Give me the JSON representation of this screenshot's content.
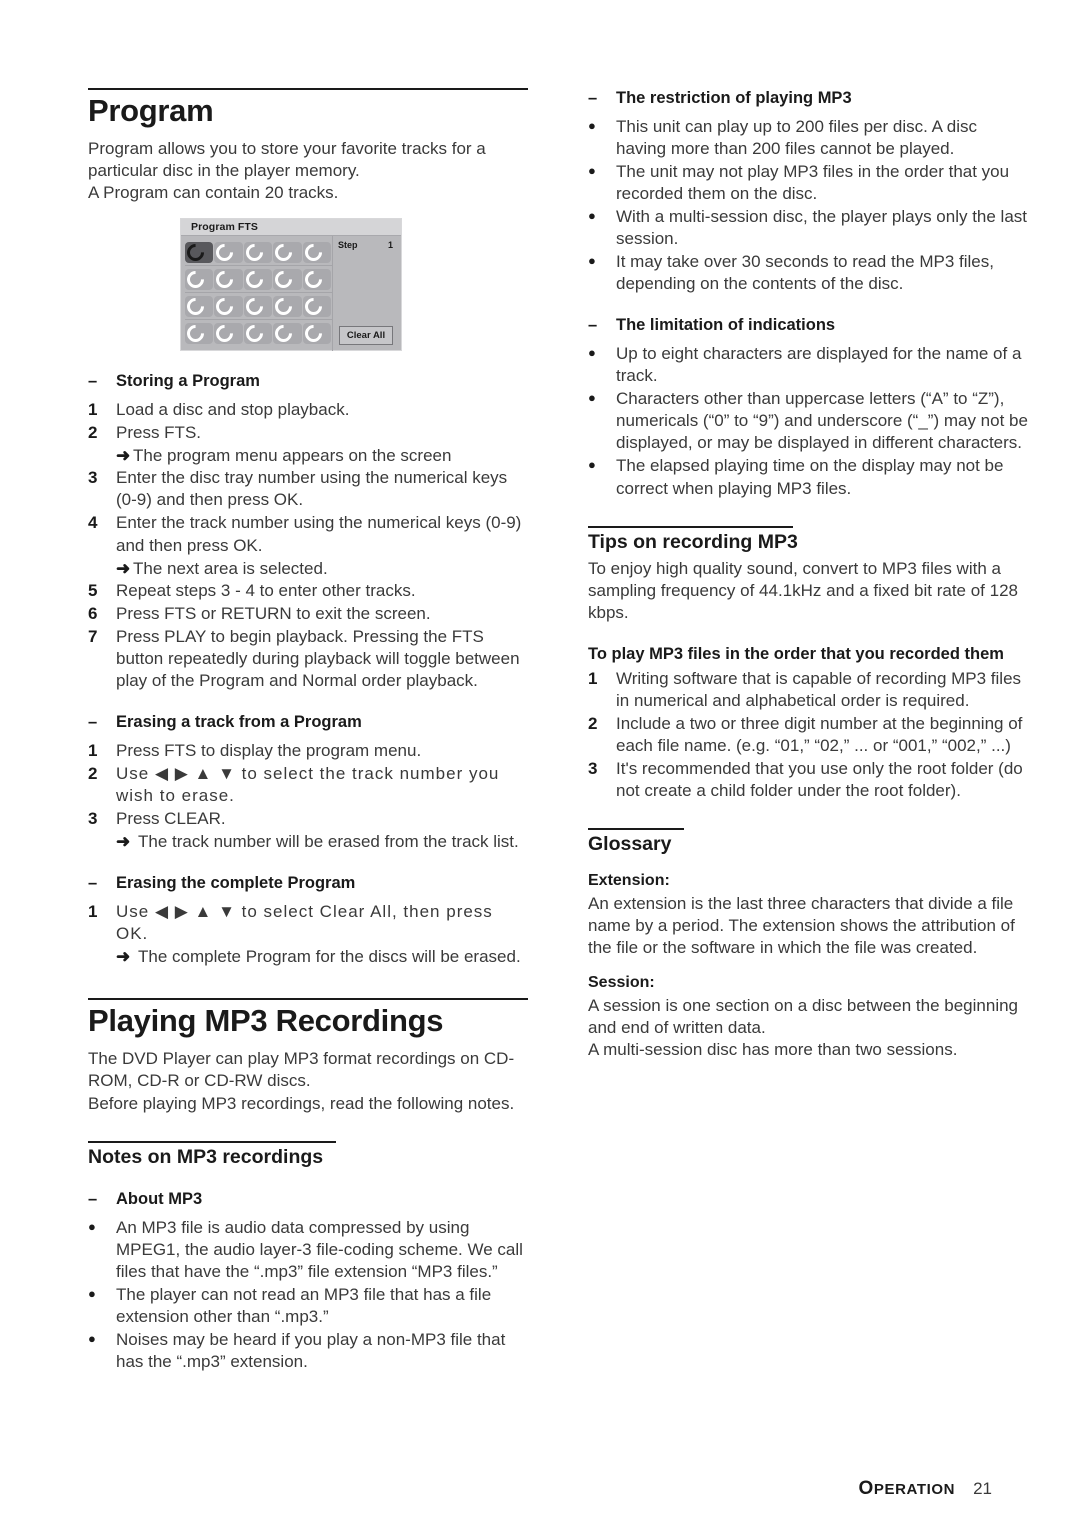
{
  "document": {
    "footer": {
      "section": "PERATION",
      "section_initial": "O",
      "page_number": "21"
    }
  },
  "left_column": {
    "heading_program": "Program",
    "intro_paragraph": "Program allows you to store your favorite tracks for a particular disc in the player memory.\nA Program can contain 20 tracks.",
    "intro_line1": "Program allows you to store your favorite tracks for a",
    "intro_line2": "particular disc in the player memory.",
    "intro_line3": "A Program can contain 20 tracks.",
    "figure": {
      "title": "Program FTS",
      "step_label": "Step",
      "step_value": "1",
      "clear_all_label": "Clear All",
      "rows": 4,
      "cols": 5,
      "selected_cell": 0
    },
    "storing_program": {
      "dash": "–",
      "title": "Storing a Program",
      "steps": [
        {
          "num": "1",
          "text": "Load a disc and stop playback."
        },
        {
          "num": "2",
          "text": "Press FTS."
        },
        {
          "num": "3",
          "text": "Enter the disc tray number using the numerical keys (0-9) and then press OK."
        },
        {
          "num": "4",
          "text": "Enter the track number using the numerical keys (0-9) and then press OK."
        },
        {
          "num": "5",
          "text": "Repeat steps 3 - 4 to enter other tracks."
        },
        {
          "num": "6",
          "text": "Press FTS or RETURN to exit the screen."
        },
        {
          "num": "7",
          "text": "Press PLAY to begin playback. Pressing the FTS button repeatedly during playback will toggle between play of the Program and Normal order playback."
        }
      ],
      "note_after_2": "The program menu appears on the screen",
      "note_after_4": "The next area is selected."
    },
    "erasing_track": {
      "dash": "–",
      "title": "Erasing a track from a Program",
      "steps": [
        {
          "num": "1",
          "text": "Press FTS to display the program menu."
        },
        {
          "num": "2",
          "text": "Use ◀ ▶ ▲ ▼ to select the track number you wish to erase."
        },
        {
          "num": "3",
          "text": "Press CLEAR."
        }
      ],
      "note_after_3": "The track number will be erased from the track list."
    },
    "erasing_complete": {
      "dash": "–",
      "title": "Erasing the complete Program",
      "steps": [
        {
          "num": "1",
          "text": "Use ◀ ▶ ▲ ▼ to select Clear All, then press OK."
        }
      ],
      "note_after_1": "The complete Program for the discs will be erased."
    },
    "heading_playing_mp3": "Playing MP3 Recordings",
    "playing_mp3_line1": "The DVD Player can play MP3 format recordings on CD-",
    "playing_mp3_line2": "ROM, CD-R or CD-RW discs.",
    "playing_mp3_line3": "Before playing MP3 recordings, read the following notes.",
    "heading_notes_mp3": "Notes on MP3 recordings",
    "about_mp3": {
      "dash": "–",
      "title": "About MP3",
      "bullets": [
        "An MP3 file is audio data compressed by using MPEG1, the audio layer-3 file-coding scheme. We call files that have the “.mp3” file extension “MP3 files.”",
        "The player can not read an MP3 file that has a file extension other than “.mp3.”",
        "Noises may be heard if you play a non-MP3 file that has the “.mp3” extension."
      ]
    }
  },
  "right_column": {
    "restriction_mp3": {
      "dash": "–",
      "title": "The restriction of playing MP3",
      "bullets": [
        "This unit can play up to 200 files per disc. A disc having more than 200 files cannot be played.",
        "The unit may not play MP3 files in the order that you recorded them on the disc.",
        "With a multi-session disc, the player plays only the last session.",
        "It may take over 30 seconds to read the MP3 files, depending on the contents of the disc."
      ]
    },
    "limitation_indications": {
      "dash": "–",
      "title": "The limitation of indications",
      "bullets": [
        "Up to eight characters are displayed for the name of a track.",
        "Characters other than uppercase letters (“A” to “Z”), numericals (“0” to “9”) and underscore (“_”) may not be displayed, or may be displayed in different characters.",
        "The elapsed playing time on the display may not be correct when playing MP3 files."
      ]
    },
    "heading_tips": "Tips on recording MP3",
    "tips_paragraph": "To enjoy high quality sound, convert to MP3 files with a sampling frequency of 44.1kHz and a fixed bit rate of 128 kbps.",
    "order_heading": "To play MP3 files in the order that you recorded them",
    "order_steps": [
      {
        "num": "1",
        "text": "Writing software that is capable of recording MP3 files in numerical and alphabetical order is required."
      },
      {
        "num": "2",
        "text": "Include a two or three digit number at the beginning of each file name. (e.g. “01,” “02,” ... or “001,” “002,” ...)"
      },
      {
        "num": "3",
        "text": "It's recommended that you use only the root folder (do not create a child folder under the root folder)."
      }
    ],
    "heading_glossary": "Glossary",
    "glossary": [
      {
        "term": "Extension:",
        "definition": "An extension is the last three characters that divide a file name by a period. The extension shows the attribution of the file or the software in which the file was created."
      },
      {
        "term": "Session:",
        "definition": "A session is one section on a disc between the beginning and end of written data.\nA multi-session disc has more than two sessions."
      }
    ],
    "session_line1": "A session is one section on a disc between the beginning and end of written data.",
    "session_line2": "A multi-session disc has more than two sessions."
  },
  "symbols": {
    "arrow": "➜",
    "bullet": "●",
    "dash": "–"
  }
}
